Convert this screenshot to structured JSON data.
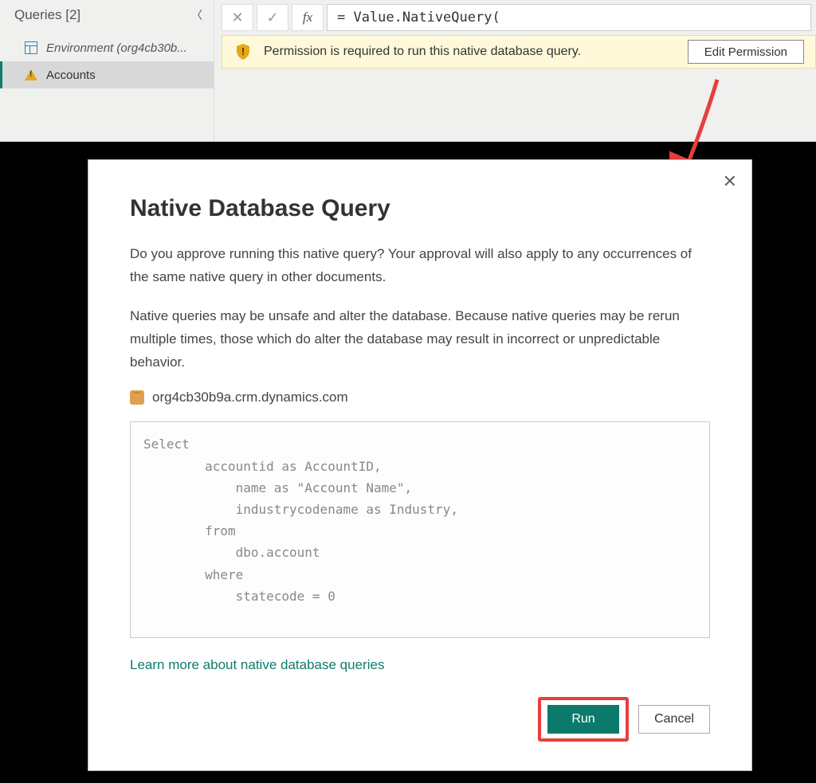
{
  "sidebar": {
    "title": "Queries [2]",
    "items": [
      {
        "label": "Environment (org4cb30b...",
        "icon": "table-icon",
        "italic": true
      },
      {
        "label": "Accounts",
        "icon": "warning-icon",
        "selected": true
      }
    ]
  },
  "formula_bar": {
    "cancel": "✕",
    "accept": "✓",
    "fx": "fx",
    "formula": "= Value.NativeQuery("
  },
  "permission_banner": {
    "text": "Permission is required to run this native database query.",
    "button": "Edit Permission"
  },
  "dialog": {
    "title": "Native Database Query",
    "para1": "Do you approve running this native query? Your approval will also apply to any occurrences of the same native query in other documents.",
    "para2": "Native queries may be unsafe and alter the database. Because native queries may be rerun multiple times, those which do alter the database may result in incorrect or unpredictable behavior.",
    "source": "org4cb30b9a.crm.dynamics.com",
    "query": "Select\n        accountid as AccountID,\n            name as \"Account Name\",\n            industrycodename as Industry,\n        from\n            dbo.account\n        where\n            statecode = 0",
    "learn_more": "Learn more about native database queries",
    "run": "Run",
    "cancel": "Cancel"
  }
}
